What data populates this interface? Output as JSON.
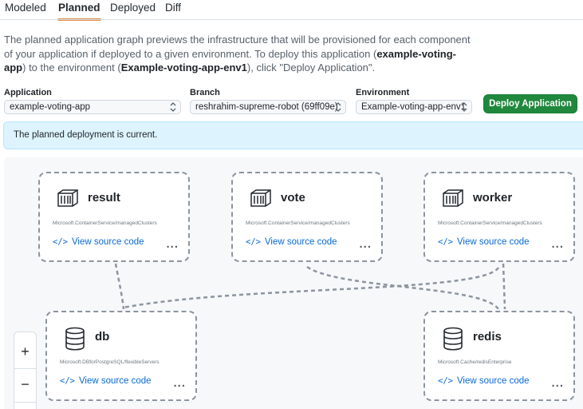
{
  "tabs": [
    {
      "label": "Modeled",
      "active": false
    },
    {
      "label": "Planned",
      "active": true
    },
    {
      "label": "Deployed",
      "active": false
    },
    {
      "label": "Diff",
      "active": false
    }
  ],
  "description": {
    "part1": "The planned application graph previews the infrastructure that will be provisioned for each component of your application if deployed to a given environment. To deploy this application (",
    "app_name": "example-voting-app",
    "part2": ") to the environment (",
    "env_name": "Example-voting-app-env1",
    "part3": "), click \"Deploy Application\"."
  },
  "selectors": {
    "application": {
      "label": "Application",
      "value": "example-voting-app"
    },
    "branch": {
      "label": "Branch",
      "value": "reshrahim-supreme-robot (69ff09e)"
    },
    "environment": {
      "label": "Environment",
      "value": "Example-voting-app-env1"
    }
  },
  "deploy_button": "Deploy Application",
  "banner": "The planned deployment is current.",
  "nodes": [
    {
      "name": "result",
      "type": "Microsoft.ContainerService/managedClusters",
      "icon": "container-icon",
      "source_link": "View source code",
      "more": "..."
    },
    {
      "name": "vote",
      "type": "Microsoft.ContainerService/managedClusters",
      "icon": "container-icon",
      "source_link": "View source code",
      "more": "..."
    },
    {
      "name": "worker",
      "type": "Microsoft.ContainerService/managedClusters",
      "icon": "container-icon",
      "source_link": "View source code",
      "more": "..."
    },
    {
      "name": "db",
      "type": "Microsoft.DBforPostgreSQL/flexibleServers",
      "icon": "database-icon",
      "source_link": "View source code",
      "more": "..."
    },
    {
      "name": "redis",
      "type": "Microsoft.Cache/redisEnterprise",
      "icon": "database-icon",
      "source_link": "View source code",
      "more": "..."
    }
  ],
  "zoom": {
    "in": "+",
    "out": "−"
  },
  "colors": {
    "accent_tab": "#e08a4a",
    "deploy_green": "#1f883d",
    "link_blue": "#0969da",
    "banner_bg": "#ddf4ff"
  }
}
